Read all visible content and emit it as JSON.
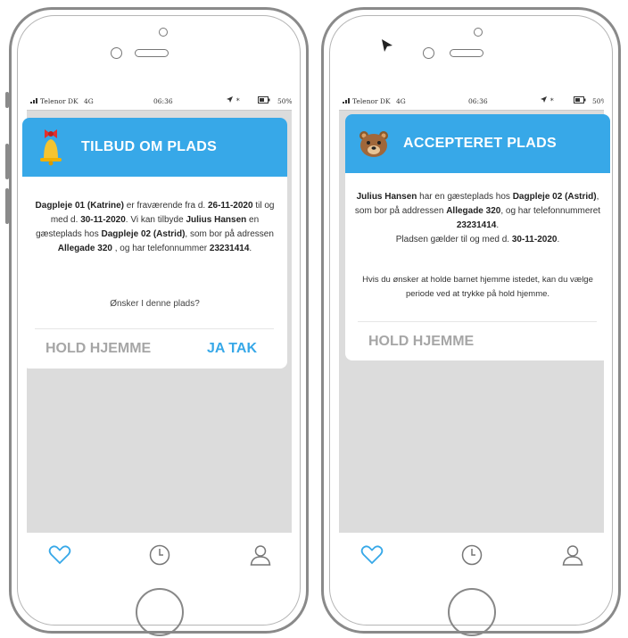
{
  "status_bar": {
    "carrier": "Telenor DK",
    "network": "4G",
    "time": "06:36",
    "battery": "50%"
  },
  "left_screen": {
    "title": "TILBUD OM PLADS",
    "icon": "bell-icon",
    "body_parts": {
      "p1": "Dagpleje 01 (Katrine)",
      "p2": " er fraværende fra d. ",
      "p3": "26-11-2020",
      "p4": " til og med d. ",
      "p5": "30-11-2020",
      "p6": ". Vi kan tilbyde ",
      "p7": "Julius Hansen",
      "p8": " en gæsteplads hos ",
      "p9": "Dagpleje 02 (Astrid)",
      "p10": ", som bor på adressen ",
      "p11": "Allegade 320",
      "p12": " , og har telefonnummer ",
      "p13": "23231414",
      "p14": "."
    },
    "question": "Ønsker I denne plads?",
    "hold_label": "HOLD HJEMME",
    "accept_label": "JA TAK"
  },
  "right_screen": {
    "title": "ACCEPTERET PLADS",
    "icon": "bear-icon",
    "body_parts": {
      "p1": "Julius Hansen",
      "p2": " har en gæsteplads hos ",
      "p3": "Dagpleje 02 (Astrid)",
      "p4": ", som bor på addressen ",
      "p5": "Allegade 320",
      "p6": ", og har telefonnummeret ",
      "p7": "23231414",
      "p8": ".",
      "p9": "Pladsen gælder til og med d. ",
      "p10": "30-11-2020",
      "p11": "."
    },
    "note": "Hvis du ønsker at holde barnet hjemme istedet, kan du vælge periode ved at trykke på hold hjemme.",
    "hold_label": "HOLD HJEMME"
  },
  "tabbar": {
    "items": [
      "heart-icon",
      "clock-icon",
      "user-icon"
    ],
    "active_color": "#37a8e8",
    "inactive_color": "#777777"
  },
  "colors": {
    "accent": "#37a8e8",
    "screen_bg": "#dcdcdc",
    "muted": "#a6a6a6"
  }
}
